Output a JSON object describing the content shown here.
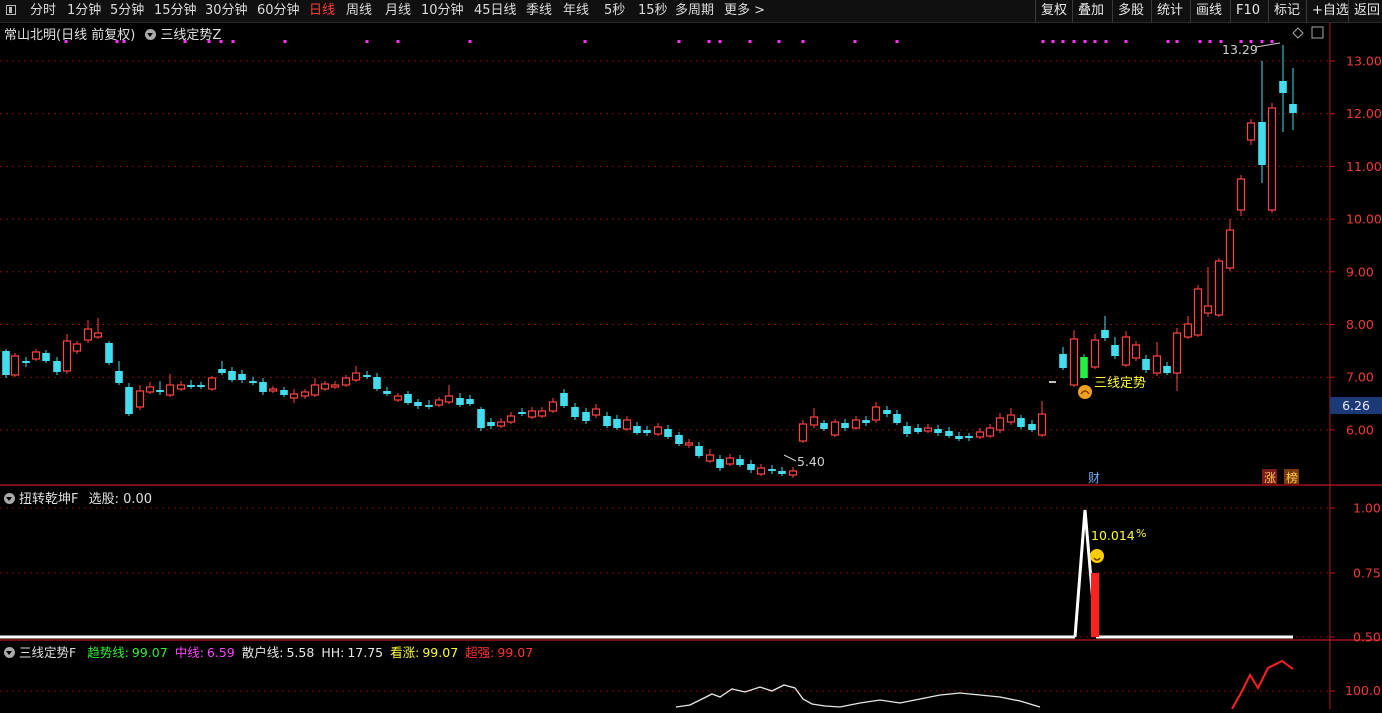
{
  "toolbar": {
    "tabs": [
      "分时",
      "1分钟",
      "5分钟",
      "15分钟",
      "30分钟",
      "60分钟",
      "日线",
      "周线",
      "月线",
      "10分钟",
      "45日线",
      "季线",
      "年线",
      "5秒",
      "15秒",
      "多周期",
      "更多 >"
    ],
    "active_tab": "日线",
    "right_buttons": [
      "复权",
      "叠加",
      "多股",
      "统计",
      "画线",
      "F10",
      "标记",
      "+自选",
      "返回"
    ]
  },
  "main_panel": {
    "stock_title": "常山北明(日线 前复权)",
    "indicator_name": "三线定势Z",
    "current_price": "6.26",
    "high_label": "13.29",
    "low_label": "5.40",
    "signal_label": "三线定势",
    "badges": [
      "财",
      "涨",
      "榜"
    ],
    "y_ticks": [
      "13.00",
      "12.00",
      "11.00",
      "10.00",
      "9.00",
      "8.00",
      "7.00",
      "6.00"
    ]
  },
  "sub_panel_1": {
    "title": "扭转乾坤F",
    "value_label": "选股: 0.00",
    "annotation": "10.014",
    "annotation_unit": "%",
    "y_ticks": [
      "1.00",
      "0.75",
      "0.50"
    ]
  },
  "sub_panel_2": {
    "title": "三线定势F",
    "fields": [
      {
        "label": "趋势线:",
        "value": "99.07",
        "color": "#33ee33"
      },
      {
        "label": "中线:",
        "value": "6.59",
        "color": "#ff44ff"
      },
      {
        "label": "散户线:",
        "value": "5.58",
        "color": "#e8e8e8"
      },
      {
        "label": "HH:",
        "value": "17.75",
        "color": "#e8e8e8"
      },
      {
        "label": "看涨:",
        "value": "99.07",
        "color": "#ffff33"
      },
      {
        "label": "超强:",
        "value": "99.07",
        "color": "#ff3333"
      }
    ],
    "y_ticks": [
      "100.0"
    ]
  },
  "colors": {
    "up": "#ff4444",
    "down": "#44ddee",
    "grid": "#7a1010",
    "axis": "#c01818",
    "label": "#ee3a3a",
    "magenta": "#ff33ff",
    "yellow": "#ffff33",
    "white": "#ffffff"
  }
}
